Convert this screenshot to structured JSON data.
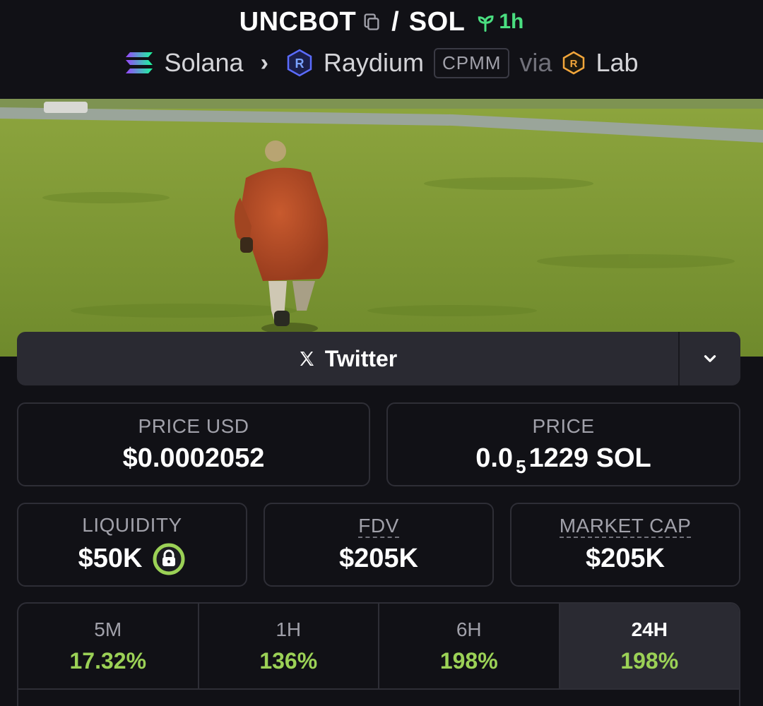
{
  "header": {
    "base_token": "UNCBOT",
    "separator": "/",
    "quote_token": "SOL",
    "pair_age": "1h",
    "chain": "Solana",
    "dex": "Raydium",
    "pool_type": "CPMM",
    "via_label": "via",
    "launchpad": "Lab"
  },
  "social": {
    "twitter_label": "Twitter"
  },
  "stats": {
    "price_usd_label": "PRICE USD",
    "price_usd_value": "$0.0002052",
    "price_label": "PRICE",
    "price_prefix": "0.0",
    "price_zeros": "5",
    "price_suffix": "1229 SOL",
    "liquidity_label": "LIQUIDITY",
    "liquidity_value": "$50K",
    "fdv_label": "FDV",
    "fdv_value": "$205K",
    "mcap_label": "MARKET CAP",
    "mcap_value": "$205K"
  },
  "timeframes": [
    {
      "label": "5M",
      "value": "17.32%"
    },
    {
      "label": "1H",
      "value": "136%"
    },
    {
      "label": "6H",
      "value": "198%"
    },
    {
      "label": "24H",
      "value": "198%"
    }
  ],
  "colors": {
    "positive": "#9bd156",
    "age_green": "#4ade80",
    "background": "#111116",
    "panel": "#2a2a32"
  },
  "icons": {
    "copy": "copy-icon",
    "age": "seedling-icon",
    "chain": "solana-icon",
    "dex": "raydium-icon",
    "launchpad": "raydium-lab-icon",
    "social": "x-icon",
    "expand": "chevron-down-icon",
    "liquidity_lock": "lock-icon"
  }
}
